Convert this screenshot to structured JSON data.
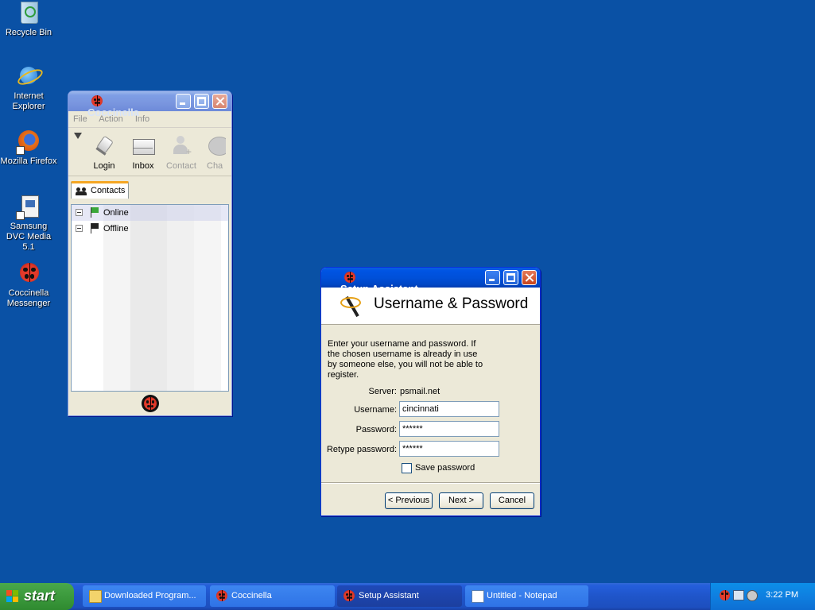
{
  "desktop": {
    "icons": [
      {
        "label": "Recycle Bin"
      },
      {
        "label": "Internet Explorer"
      },
      {
        "label": "Mozilla Firefox"
      },
      {
        "label": "Samsung DVC Media 5.1"
      },
      {
        "label": "Coccinella Messenger"
      }
    ]
  },
  "coccinella": {
    "title": "Coccinella",
    "menu": [
      "File",
      "Action",
      "Info"
    ],
    "toolbar": [
      "Login",
      "Inbox",
      "Contact",
      "Cha"
    ],
    "tab": "Contacts",
    "groups": [
      "Online",
      "Offline"
    ]
  },
  "setup": {
    "title": "Setup Assistant",
    "header": "Username & Password",
    "intro": "Enter your username and password. If the chosen username is already in use by someone else, you will not be able to register.",
    "server_label": "Server:",
    "server_value": "psmail.net",
    "username_label": "Username:",
    "username_value": "cincinnati",
    "password_label": "Password:",
    "password_value": "******",
    "retype_label": "Retype password:",
    "retype_value": "******",
    "save_label": "Save password",
    "prev_label": "< Previous",
    "next_label": "Next >",
    "cancel_label": "Cancel"
  },
  "taskbar": {
    "start_label": "start",
    "tasks": [
      "Downloaded Program...",
      "Coccinella",
      "Setup Assistant",
      "Untitled - Notepad"
    ],
    "clock": "3:22 PM"
  },
  "colors": {
    "desktop": "#0a51a5",
    "titlebar": "#0054e3",
    "start": "#3c9a3d"
  }
}
